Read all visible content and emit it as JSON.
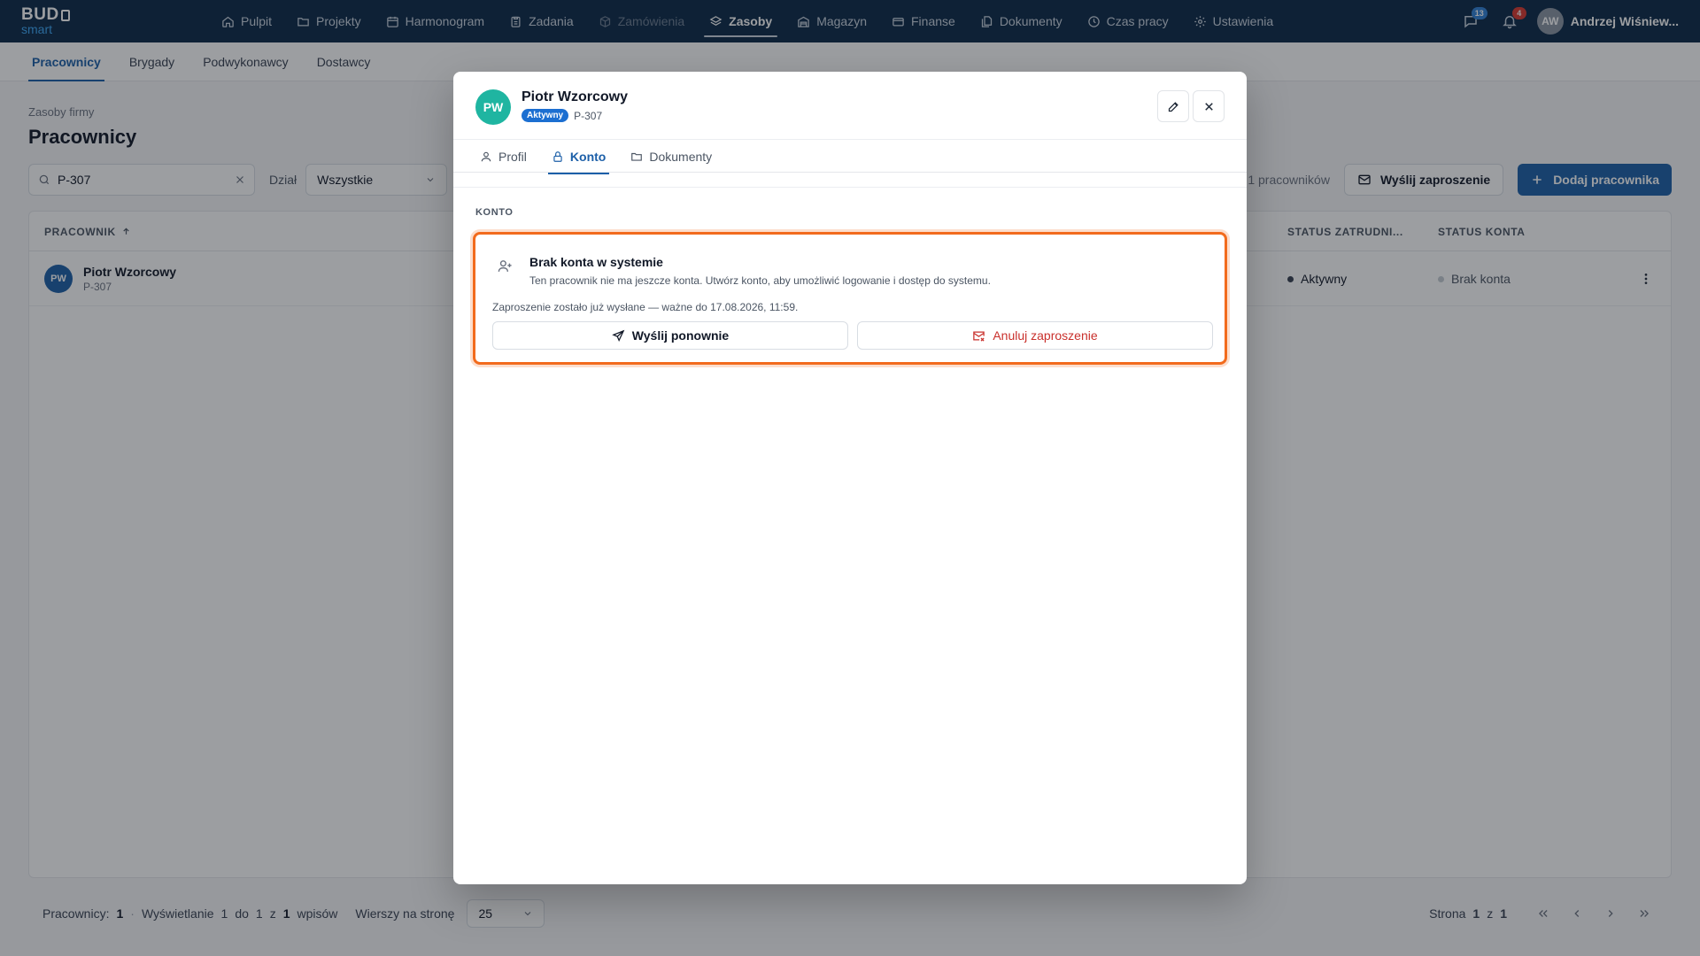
{
  "brand": {
    "line1": "BUD",
    "line2": "smart"
  },
  "nav": {
    "items": [
      {
        "label": "Pulpit"
      },
      {
        "label": "Projekty"
      },
      {
        "label": "Harmonogram"
      },
      {
        "label": "Zadania"
      },
      {
        "label": "Zamówienia"
      },
      {
        "label": "Zasoby"
      },
      {
        "label": "Magazyn"
      },
      {
        "label": "Finanse"
      },
      {
        "label": "Dokumenty"
      },
      {
        "label": "Czas pracy"
      },
      {
        "label": "Ustawienia"
      }
    ],
    "messages_badge": "13",
    "notifications_badge": "4",
    "user_initials": "AW",
    "user_name": "Andrzej Wiśniew..."
  },
  "subtabs": [
    "Pracownicy",
    "Brygady",
    "Podwykonawcy",
    "Dostawcy"
  ],
  "page": {
    "breadcrumb": "Zasoby firmy",
    "title": "Pracownicy",
    "search_value": "P-307",
    "department_label": "Dział",
    "department_value": "Wszystkie",
    "employee_count": "1 pracowników",
    "send_invite": "Wyślij zaproszenie",
    "add_employee": "Dodaj pracownika"
  },
  "table": {
    "headers": {
      "employee": "PRACOWNIK",
      "employment_status": "STATUS ZATRUDNI...",
      "account_status": "STATUS KONTA"
    },
    "rows": [
      {
        "initials": "PW",
        "name": "Piotr Wzorcowy",
        "code": "P-307",
        "employment_status": "Aktywny",
        "account_status": "Brak konta"
      }
    ]
  },
  "footer": {
    "label_count": "Pracownicy:",
    "count": "1",
    "sep": "·",
    "showing_prefix": "Wyświetlanie",
    "from": "1",
    "to_word": "do",
    "to": "1",
    "of_word": "z",
    "total": "1",
    "entries": "wpisów",
    "rows_per_page_label": "Wierszy na stronę",
    "rows_per_page": "25",
    "page_label": "Strona",
    "page": "1",
    "page_of": "z",
    "pages": "1"
  },
  "modal": {
    "initials": "PW",
    "name": "Piotr Wzorcowy",
    "badge": "Aktywny",
    "code": "P-307",
    "tabs": [
      "Profil",
      "Konto",
      "Dokumenty"
    ],
    "section_title": "KONTO",
    "account": {
      "title": "Brak konta w systemie",
      "description": "Ten pracownik nie ma jeszcze konta. Utwórz konto, aby umożliwić logowanie i dostęp do systemu.",
      "note": "Zaproszenie zostało już wysłane — ważne do 17.08.2026, 11:59.",
      "resend": "Wyślij ponownie",
      "cancel": "Anuluj zaproszenie"
    }
  },
  "colors": {
    "topbar": "#0c2847",
    "primary": "#1c5fa8",
    "highlight": "#f26b1d",
    "danger": "#c9302c",
    "modal_avatar": "#1fb5a1"
  }
}
